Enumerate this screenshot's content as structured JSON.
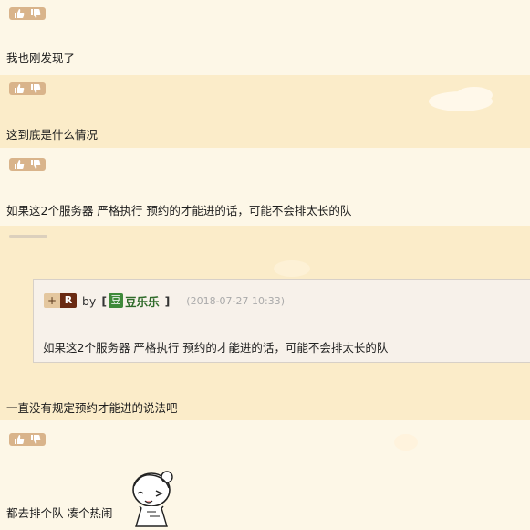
{
  "comments": [
    {
      "text": "我也刚发现了"
    },
    {
      "text": "这到底是什么情况"
    },
    {
      "text": "如果这2个服务器 严格执行 预约的才能进的话，可能不会排太长的队"
    },
    {
      "text": "一直没有规定预约才能进的说法吧"
    },
    {
      "text": "都去排个队 凑个热闹"
    }
  ],
  "quote": {
    "rank_plus": "+",
    "rank_letter": "R",
    "by_label": "by",
    "bracket_open": "[",
    "bracket_close": "]",
    "user_icon": "豆",
    "user_name": "豆乐乐",
    "timestamp": "(2018-07-27 10:33)",
    "body": "如果这2个服务器 严格执行 预约的才能进的话，可能不会排太长的队"
  },
  "icons": {
    "like": "thumbs-up-icon",
    "dislike": "thumbs-down-icon",
    "user_badge": "dou-badge-icon"
  },
  "colors": {
    "band_light": "#fdf7e7",
    "band_dark": "#fbecc9",
    "vote_pill": "#d9b48b",
    "rank_letter_bg": "#6a2a12",
    "user_badge_bg": "#3f8a3a",
    "user_name": "#2f6b2a"
  }
}
